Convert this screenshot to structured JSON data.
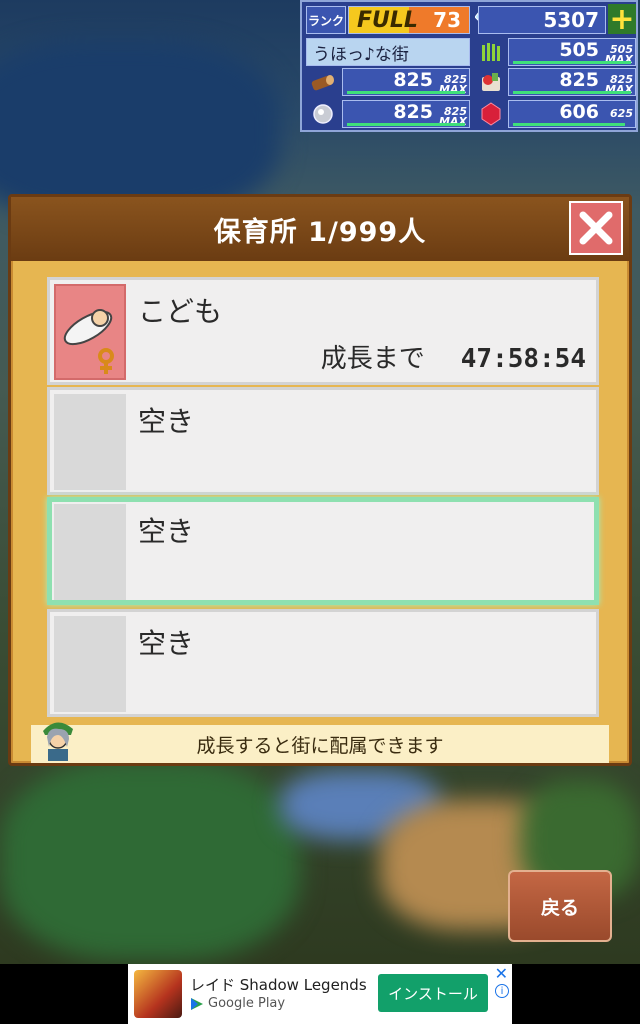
{
  "hud": {
    "rank_label": "ランク",
    "rank_status": "FULL",
    "rank_value": "73",
    "gems": "5307",
    "plus_label": "+",
    "town_name": "うほっ♪な街",
    "resources": [
      {
        "icon": "wheat-icon",
        "value": "505",
        "max": "505",
        "max_label": "MAX"
      },
      {
        "icon": "wood-icon",
        "value": "825",
        "max": "825",
        "max_label": "MAX"
      },
      {
        "icon": "food-icon",
        "value": "825",
        "max": "825",
        "max_label": "MAX"
      },
      {
        "icon": "ore-icon",
        "value": "825",
        "max": "825",
        "max_label": "MAX"
      },
      {
        "icon": "ruby-icon",
        "value": "606",
        "max": "625",
        "max_label": ""
      }
    ]
  },
  "dialog": {
    "title": "保育所 1/999人",
    "slots": [
      {
        "name": "こども",
        "status_label": "成長まで",
        "timer": "47:58:54"
      },
      {
        "name": "空き"
      },
      {
        "name": "空き"
      },
      {
        "name": "空き"
      }
    ],
    "tip": "成長すると街に配属できます"
  },
  "back_button": "戻る",
  "ad": {
    "title": "レイド Shadow Legends",
    "store": "Google Play",
    "install": "インストール",
    "close": "✕",
    "info": "i"
  },
  "colors": {
    "hud_bg": "#2a3f8e",
    "dialog_bg": "#e6b651",
    "dialog_header": "#7a4618",
    "close_button": "#e06b6b",
    "selected_outline": "#8ee0b0",
    "install_button": "#12a06a"
  }
}
